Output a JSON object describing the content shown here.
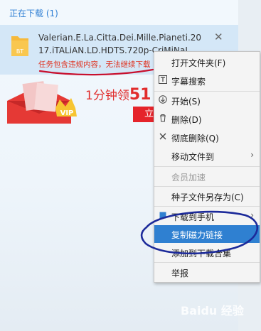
{
  "section_title": "正在下载 (1)",
  "download": {
    "icon_label": "BT",
    "file_name_line1": "Valerian.E.La.Citta.Dei.Mille.Pianeti.20",
    "file_name_line2": "17.iTALiAN.LD.HDTS.720p-CriMiNaL",
    "warning": "任务包含违规内容，无法继续下载",
    "close_symbol": "✕"
  },
  "banner": {
    "text_prefix": "1分钟领",
    "text_amount": "51",
    "button_label": "立",
    "badge": "VIP"
  },
  "menu": {
    "items": [
      {
        "label": "打开文件夹(F)",
        "icon": "",
        "disabled": false,
        "submenu": false
      },
      {
        "label": "字幕搜索",
        "icon": "subtitle-icon",
        "disabled": false,
        "submenu": false
      },
      {
        "label": "开始(S)",
        "icon": "start-icon",
        "disabled": false,
        "submenu": false
      },
      {
        "label": "删除(D)",
        "icon": "trash-icon",
        "disabled": false,
        "submenu": false
      },
      {
        "label": "彻底删除(Q)",
        "icon": "x-icon",
        "disabled": false,
        "submenu": false
      },
      {
        "label": "移动文件到",
        "icon": "",
        "disabled": false,
        "submenu": true
      },
      {
        "label": "会员加速",
        "icon": "",
        "disabled": true,
        "submenu": false
      },
      {
        "label": "种子文件另存为(C)",
        "icon": "",
        "disabled": false,
        "submenu": false
      },
      {
        "label": "下载到手机",
        "icon": "phone-icon",
        "disabled": false,
        "submenu": true
      },
      {
        "label": "复制磁力链接",
        "icon": "",
        "disabled": false,
        "submenu": false,
        "highlighted": true
      },
      {
        "label": "添加到下载合集",
        "icon": "",
        "disabled": false,
        "submenu": false
      },
      {
        "label": "举报",
        "icon": "",
        "disabled": false,
        "submenu": false
      }
    ],
    "submenu_arrow": "›"
  },
  "watermark": "Baidu 经验",
  "colors": {
    "accent": "#2f80d1",
    "warning": "#e0301e",
    "annotation": "#c8102e"
  }
}
